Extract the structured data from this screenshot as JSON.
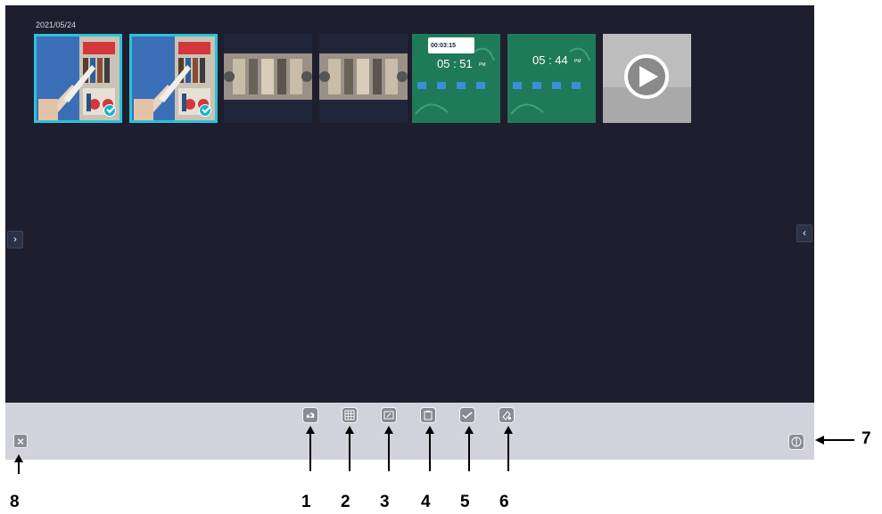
{
  "gallery": {
    "date_label": "2021/05/24",
    "thumbnails": [
      {
        "kind": "photo",
        "selected": true
      },
      {
        "kind": "photo",
        "selected": true
      },
      {
        "kind": "pattern",
        "selected": false
      },
      {
        "kind": "pattern",
        "selected": false
      },
      {
        "kind": "screen",
        "time": "00:03:15",
        "clock": "05 : 51",
        "suffix": "PM",
        "selected": false
      },
      {
        "kind": "screen",
        "clock": "05 : 44",
        "suffix": "PM",
        "selected": false
      },
      {
        "kind": "video",
        "selected": false
      }
    ],
    "left_handle_icon": "chevron-right-icon",
    "right_handle_icon": "chevron-left-icon"
  },
  "toolbar": {
    "tools": [
      {
        "icon": "cloud-upload-icon",
        "callout": "1"
      },
      {
        "icon": "grid-icon",
        "callout": "2"
      },
      {
        "icon": "whiteboard-icon",
        "callout": "3"
      },
      {
        "icon": "clipboard-icon",
        "callout": "4"
      },
      {
        "icon": "checkmark-icon",
        "callout": "5"
      },
      {
        "icon": "eraser-icon",
        "callout": "6"
      }
    ],
    "close_callout": "8",
    "switch_callout": "7"
  },
  "colors": {
    "screen_bg": "#1e1e2e",
    "toolbar_bg": "#d2d2dd",
    "selection": "#2ac3d8",
    "thumb_green": "#1f7a5a"
  }
}
